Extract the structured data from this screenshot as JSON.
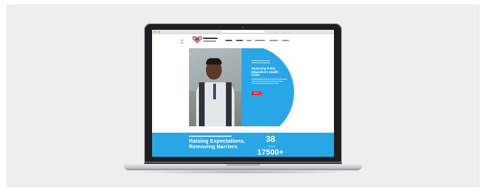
{
  "hero": {
    "title": "Removing Public Education's Health Crisis",
    "button_label": "Donate"
  },
  "stats_band": {
    "headline_line1": "Raising Expectations,",
    "headline_line2": "Removing Barriers",
    "stat1_value": "38",
    "stat1_label": "Schools",
    "stat2_value": "17500+"
  },
  "colors": {
    "brand_blue": "#29a6e6",
    "accent_red": "#e5242f",
    "backdrop": "#eeeeee"
  },
  "icons": {
    "menu": "menu-icon",
    "logo": "heart-logo-icon"
  }
}
